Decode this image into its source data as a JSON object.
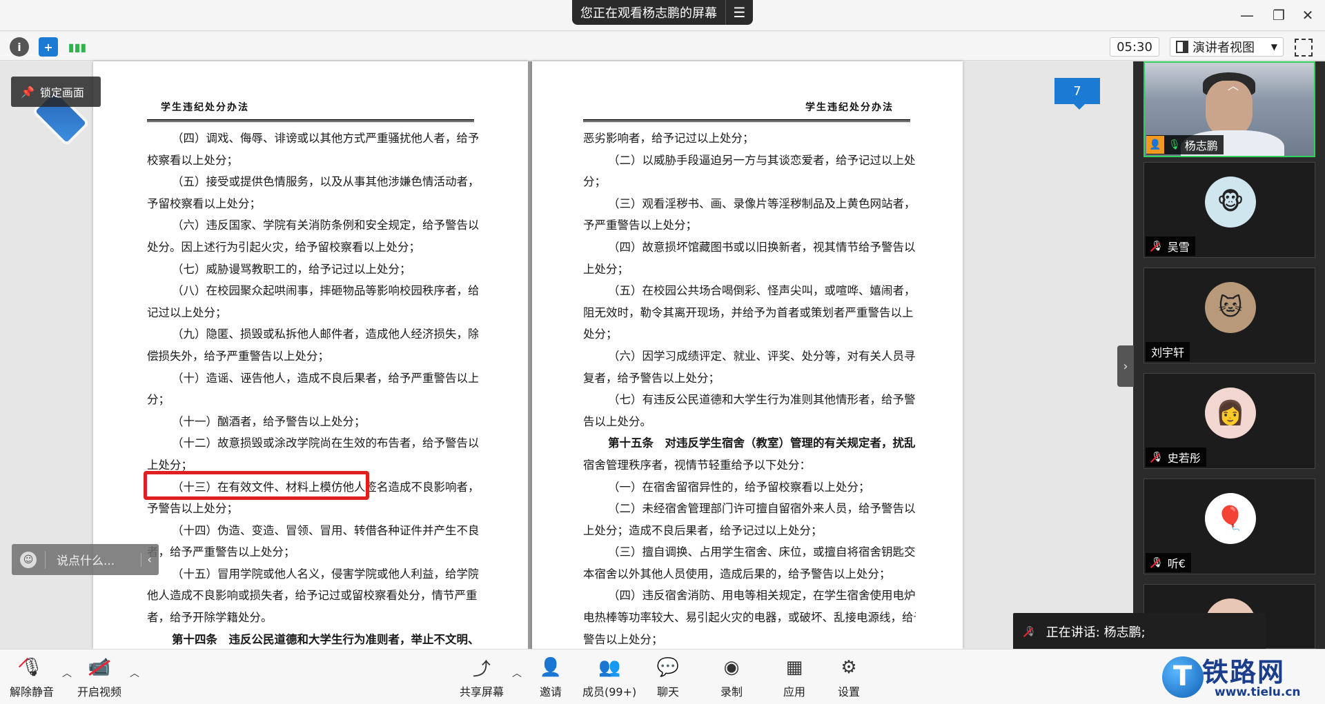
{
  "top": {
    "share_notice": "您正在观看杨志鹏的屏幕",
    "timer": "05:30",
    "view_mode": "演讲者视图"
  },
  "overlays": {
    "lock_screen": "锁定画面",
    "chat_placeholder": "说点什么...",
    "page_number": "7",
    "speaking": "正在讲话: 杨志鹏;"
  },
  "document": {
    "left_header": "学生违纪处分办法",
    "right_header": "学生违纪处分办法",
    "left_lines": [
      {
        "t": "（四）调戏、侮辱、诽谤或以其他方式严重骚扰他人者，给予留",
        "indent": true
      },
      {
        "t": "校察看以上处分；",
        "indent": false
      },
      {
        "t": "（五）接受或提供色情服务，以及从事其他涉嫌色情活动者，给",
        "indent": true
      },
      {
        "t": "予留校察看以上处分；",
        "indent": false
      },
      {
        "t": "（六）违反国家、学院有关消防条例和安全规定，给予警告以上",
        "indent": true
      },
      {
        "t": "处分。因上述行为引起火灾，给予留校察看以上处分；",
        "indent": false
      },
      {
        "t": "（七）威胁谩骂教职工的，给予记过以上处分；",
        "indent": true
      },
      {
        "t": "（八）在校园聚众起哄闹事，摔砸物品等影响校园秩序者，给予",
        "indent": true
      },
      {
        "t": "记过以上处分；",
        "indent": false
      },
      {
        "t": "（九）隐匿、损毁或私拆他人邮件者，造成他人经济损失，除赔",
        "indent": true
      },
      {
        "t": "偿损失外，给予严重警告以上处分；",
        "indent": false
      },
      {
        "t": "（十）造谣、诬告他人，造成不良后果者，给予严重警告以上处",
        "indent": true
      },
      {
        "t": "分；",
        "indent": false
      },
      {
        "t": "（十一）酗酒者，给予警告以上处分；",
        "indent": true
      },
      {
        "t": "（十二）故意损毁或涂改学院尚在生效的布告者，给予警告以",
        "indent": true
      },
      {
        "t": "上处分；",
        "indent": false
      },
      {
        "t": "（十三）在有效文件、材料上模仿他人签名造成不良影响者，给",
        "indent": true
      },
      {
        "t": "予警告以上处分；",
        "indent": false
      },
      {
        "t": "（十四）伪造、变造、冒领、冒用、转借各种证件并产生不良后果",
        "indent": true
      },
      {
        "t": "者，给予严重警告以上处分；",
        "indent": false
      },
      {
        "t": "（十五）冒用学院或他人名义，侵害学院或他人利益，给学院或",
        "indent": true
      },
      {
        "t": "他人造成不良影响或损失者，给予记过或留校察看处分，情节严重",
        "indent": false
      },
      {
        "t": "者，给予开除学籍处分。",
        "indent": false
      },
      {
        "t": "第十四条　违反公民道德和大学生行为准则者，举止不文明、",
        "indent": true
      }
    ],
    "right_lines": [
      {
        "t": "恶劣影响者，给予记过以上处分；",
        "indent": false
      },
      {
        "t": "（二）以威胁手段逼迫另一方与其谈恋爱者，给予记过以上处",
        "indent": true
      },
      {
        "t": "分；",
        "indent": false
      },
      {
        "t": "（三）观看淫秽书、画、录像片等淫秽制品及上黄色网站者，给",
        "indent": true
      },
      {
        "t": "予严重警告以上处分；",
        "indent": false
      },
      {
        "t": "（四）故意损坏馆藏图书或以旧换新者，视其情节给予警告以",
        "indent": true
      },
      {
        "t": "上处分；",
        "indent": false
      },
      {
        "t": "（五）在校园公共场合喝倒彩、怪声尖叫，或喧哗、嬉闹者，经劝",
        "indent": true
      },
      {
        "t": "阻无效时，勒令其离开现场，并给予为首者或策划者严重警告以上",
        "indent": false
      },
      {
        "t": "处分；",
        "indent": false
      },
      {
        "t": "（六）因学习成绩评定、就业、评奖、处分等，对有关人员寻衅报",
        "indent": true
      },
      {
        "t": "复者，给予警告以上处分；",
        "indent": false
      },
      {
        "t": "（七）有违反公民道德和大学生行为准则其他情形者，给予警",
        "indent": true
      },
      {
        "t": "告以上处分。",
        "indent": false
      },
      {
        "t": "第十五条　对违反学生宿舍（教室）管理的有关规定者，扰乱",
        "indent": true
      },
      {
        "t": "宿舍管理秩序者，视情节轻重给予以下处分：",
        "indent": false
      },
      {
        "t": "（一）在宿舍留宿异性的，给予留校察看以上处分；",
        "indent": true
      },
      {
        "t": "（二）未经宿舍管理部门许可擅自留宿外来人员，给予警告以",
        "indent": true
      },
      {
        "t": "上处分；造成不良后果者，给予记过以上处分；",
        "indent": false
      },
      {
        "t": "（三）擅自调换、占用学生宿舍、床位，或擅自将宿舍钥匙交给",
        "indent": true
      },
      {
        "t": "本宿舍以外其他人员使用，造成后果的，给予警告以上处分；",
        "indent": false
      },
      {
        "t": "（四）违反宿舍消防、用电等相关规定，在学生宿舍使用电炉、",
        "indent": true
      },
      {
        "t": "电热棒等功率较大、易引起火灾的电器，或破坏、乱接电源线，给予",
        "indent": false
      },
      {
        "t": "警告以上处分；",
        "indent": false
      }
    ]
  },
  "participants": [
    {
      "name": "杨志鹏",
      "state": "speaking",
      "top": 0
    },
    {
      "name": "吴雪",
      "state": "muted",
      "avatar": "🐵"
    },
    {
      "name": "刘宇轩",
      "state": "none",
      "avatar": "🐱"
    },
    {
      "name": "史若彤",
      "state": "muted",
      "avatar": "👩"
    },
    {
      "name": "听€",
      "state": "muted",
      "avatar": "🎈"
    }
  ],
  "bottom": {
    "unmute": "解除静音",
    "start_video": "开启视频",
    "share_screen": "共享屏幕",
    "invite": "邀请",
    "members": "成员(99+)",
    "chat": "聊天",
    "record": "录制",
    "apps": "应用",
    "settings": "设置"
  },
  "watermark": {
    "name": "铁路网",
    "url": "www.tielu.cn"
  },
  "colors": {
    "accent_blue": "#1a7ad4",
    "highlight_red": "#e02020",
    "active_speaker_green": "#2fd05b"
  }
}
